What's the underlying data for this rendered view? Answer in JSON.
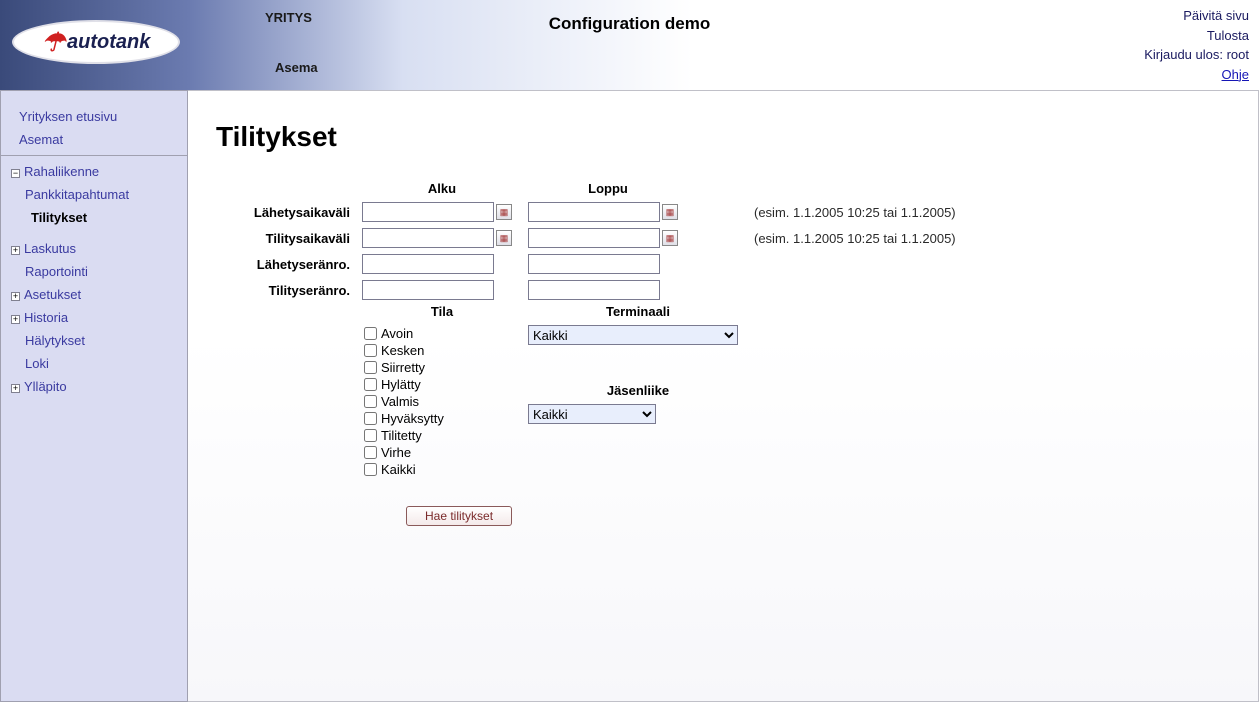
{
  "header": {
    "brand": "autotank",
    "col1_line1": "YRITYS",
    "col1_line2": "Asema",
    "title": "Configuration demo",
    "right": {
      "refresh": "Päivitä sivu",
      "print": "Tulosta",
      "logout": "Kirjaudu ulos: root",
      "help": "Ohje"
    }
  },
  "sidebar": {
    "top": [
      "Yrityksen etusivu",
      "Asemat"
    ],
    "group1": {
      "label": "Rahaliikenne",
      "children": [
        "Pankkitapahtumat",
        "Tilitykset"
      ]
    },
    "group2": {
      "label": "Laskutus",
      "children": [
        "Raportointi"
      ]
    },
    "group3": {
      "label": "Asetukset"
    },
    "group4": {
      "label": "Historia",
      "children": [
        "Hälytykset",
        "Loki"
      ]
    },
    "group5": {
      "label": "Ylläpito"
    }
  },
  "page": {
    "title": "Tilitykset",
    "cols": {
      "start": "Alku",
      "end": "Loppu"
    },
    "rows": {
      "send_interval": "Lähetysaikaväli",
      "settle_interval": "Tilitysaikaväli",
      "send_batch": "Lähetyseränro.",
      "settle_batch": "Tilityseränro."
    },
    "hint": "(esim. 1.1.2005 10:25 tai 1.1.2005)",
    "status_head": "Tila",
    "terminal_head": "Terminaali",
    "member_head": "Jäsenliike",
    "statuses": [
      "Avoin",
      "Kesken",
      "Siirretty",
      "Hylätty",
      "Valmis",
      "Hyväksytty",
      "Tilitetty",
      "Virhe",
      "Kaikki"
    ],
    "terminal_value": "Kaikki",
    "member_value": "Kaikki",
    "submit": "Hae tilitykset",
    "values": {
      "send_start": "",
      "send_end": "",
      "settle_start": "",
      "settle_end": "",
      "send_batch_start": "",
      "send_batch_end": "",
      "settle_batch_start": "",
      "settle_batch_end": ""
    }
  }
}
